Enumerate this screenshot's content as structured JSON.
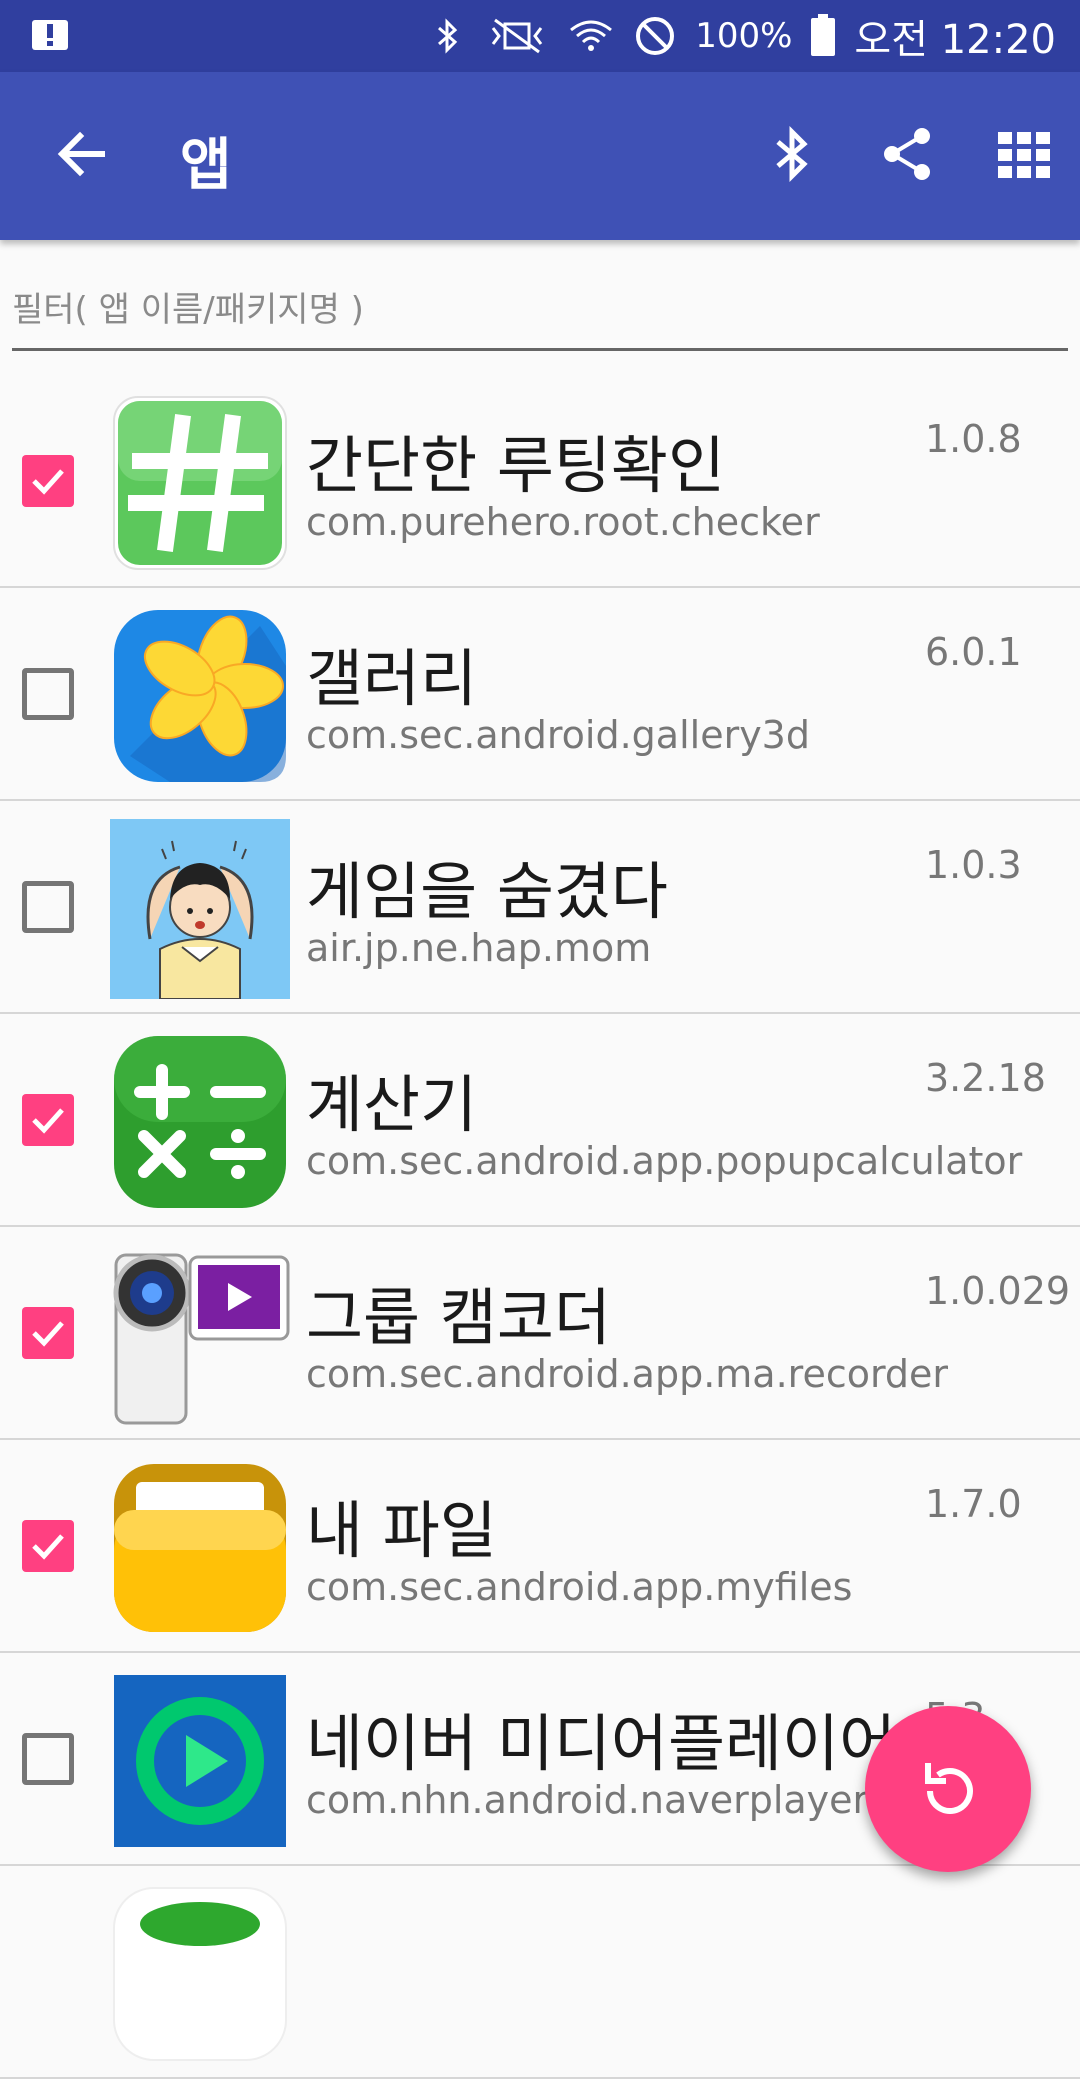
{
  "status_bar": {
    "battery_percent": "100%",
    "time": "오전 12:20",
    "icons": [
      "notification-icon",
      "bluetooth-icon",
      "vibrate-mute-icon",
      "wifi-icon",
      "do-not-disturb-icon",
      "battery-icon"
    ]
  },
  "app_bar": {
    "title": "앱",
    "colors": {
      "status": "#303f9f",
      "toolbar": "#3f51b5"
    },
    "actions": [
      "bluetooth-icon",
      "share-icon",
      "grid-view-icon"
    ]
  },
  "filter": {
    "placeholder": "필터( 앱 이름/패키지명 )"
  },
  "apps": [
    {
      "name": "간단한 루팅확인",
      "package": "com.purehero.root.checker",
      "version": "1.0.8",
      "checked": true,
      "icon": "root-checker-icon"
    },
    {
      "name": "갤러리",
      "package": "com.sec.android.gallery3d",
      "version": "6.0.1",
      "checked": false,
      "icon": "gallery-icon"
    },
    {
      "name": "게임을 숨겼다",
      "package": "air.jp.ne.hap.mom",
      "version": "1.0.3",
      "checked": false,
      "icon": "hidden-game-icon"
    },
    {
      "name": "계산기",
      "package": "com.sec.android.app.popupcalculator",
      "version": "3.2.18",
      "checked": true,
      "icon": "calculator-icon"
    },
    {
      "name": "그룹 캠코더",
      "package": "com.sec.android.app.ma.recorder",
      "version": "1.0.029",
      "checked": true,
      "icon": "camcorder-icon"
    },
    {
      "name": "내 파일",
      "package": "com.sec.android.app.myfiles",
      "version": "1.7.0",
      "checked": true,
      "icon": "my-files-icon"
    },
    {
      "name": "네이버 미디어플레이어",
      "package": "com.nhn.android.naverplayer",
      "version": "5.3",
      "checked": false,
      "icon": "naver-player-icon"
    },
    {
      "name": "",
      "package": "",
      "version": "",
      "checked": false,
      "icon": "partial-app-icon"
    }
  ],
  "fab": {
    "icon": "refresh-icon",
    "color": "#ff4081"
  }
}
